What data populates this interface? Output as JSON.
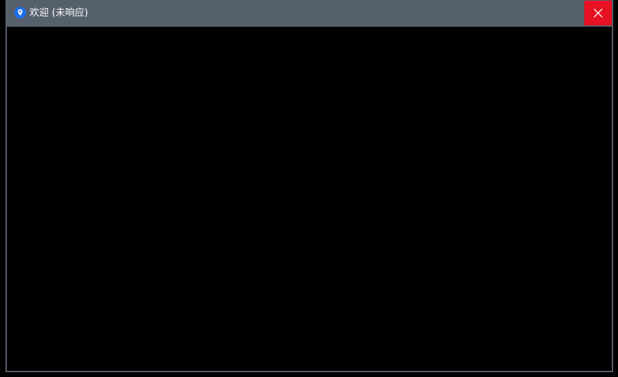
{
  "window": {
    "title": "欢迎 (未响应)",
    "app_icon": "map-pin-icon",
    "close_icon": "close-icon"
  },
  "colors": {
    "titlebar": "#56606d",
    "close_button": "#e81123",
    "app_icon": "#1a6ff2",
    "content": "#000000"
  }
}
